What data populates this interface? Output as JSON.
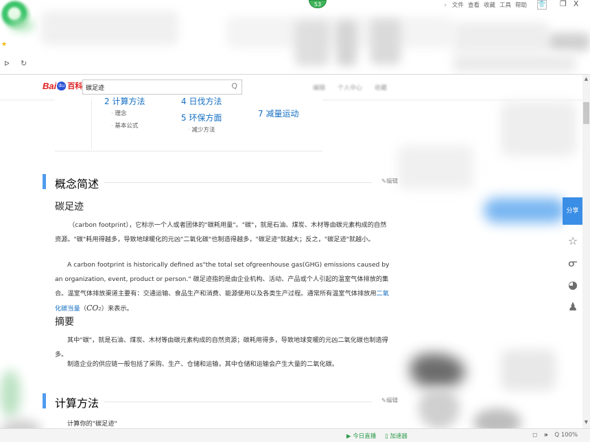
{
  "browser": {
    "badge": "53",
    "top_menu": [
      "文件",
      "查看",
      "收藏",
      "工具",
      "帮助"
    ],
    "top_menu_caret": "›",
    "window_buttons": [
      "❐",
      "X"
    ]
  },
  "header": {
    "logo_left": "Bai",
    "logo_paw": "du",
    "logo_right": "百科",
    "search_value": "碳足迹",
    "tools": [
      "编辑",
      "个人中心",
      "收藏"
    ]
  },
  "toc": {
    "items": [
      {
        "label": "2  计算方法",
        "subs": [
          "理念",
          "基本公式"
        ]
      },
      {
        "label": "4  日伐方法",
        "subs": []
      },
      {
        "label": "5  环保方面",
        "subs": [
          "减少方法"
        ]
      },
      {
        "label": "7  减量运动",
        "subs": []
      }
    ]
  },
  "sections": {
    "concept": {
      "title": "概念简述",
      "edit": "编辑",
      "subtitle": "碳足迹",
      "p1": "（carbon footprint），它标示一个人或者团体的\"碳耗用量\"。\"碳\"，就是石油、煤炭、木材等由碳元素构成的自然资源。\"碳\"耗用得越多，导致地球暖化的元凶\"二氧化碳\"也制造得越多，\"碳足迹\"就越大；反之，\"碳足迹\"就越小。",
      "p2_a": "A carbon footprint is historically defined as\"the total set ofgreenhouse gas(GHG) emissions caused by an organization, event, product or person.\" 碳足迹指的是由企业机构、活动、产品或个人引起的温室气体排放的集合。温室气体排放渠道主要有：交通运输、食品生产和消费、能源使用以及各类生产过程。通常所有温室气体排放用",
      "p2_link": "二氧化碳当量",
      "p2_b": "（",
      "p2_formula": "CO₂",
      "p2_c": "）来表示。"
    },
    "summary": {
      "title": "摘要",
      "p1": "其中\"碳\"，就是石油、煤炭、木材等由碳元素构成的自然资源；碳耗用得多，导致地球变暖的元凶二氧化碳也制造得多。",
      "p2": "制造企业的供应链一般包括了采购、生产、仓储和运输，其中仓储和运输会产生大量的二氧化碳。"
    },
    "method": {
      "title": "计算方法",
      "edit": "编辑",
      "p1": "计算你的\"碳足迹\""
    }
  },
  "sidebar": {
    "share": "分享",
    "icons": [
      "star-icon",
      "weibo-icon",
      "wechat-icon",
      "qq-icon"
    ]
  },
  "statusbar": {
    "news": "今日直播",
    "fast": "加速器",
    "right": [
      "◻",
      "🕪",
      "Q 100%"
    ]
  }
}
